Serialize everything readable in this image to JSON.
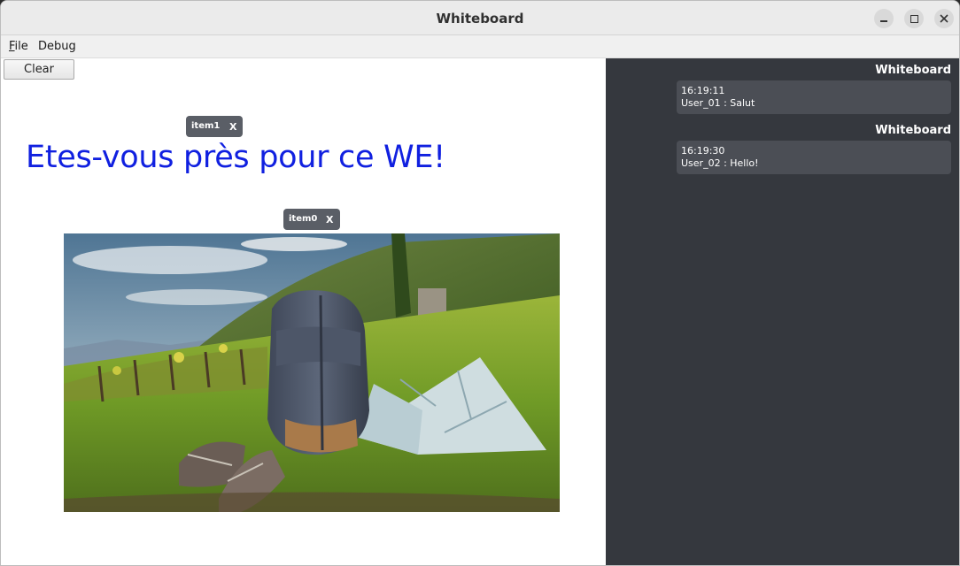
{
  "window": {
    "title": "Whiteboard"
  },
  "menubar": {
    "file_accel": "F",
    "file_rest": "ile",
    "debug_label": "Debug"
  },
  "toolbar": {
    "clear_label": "Clear"
  },
  "canvas": {
    "items": [
      {
        "label": "item1",
        "close": "X"
      },
      {
        "label": "item0",
        "close": "X"
      }
    ],
    "headline": "Etes-vous près pour ce WE!"
  },
  "chat": {
    "messages": [
      {
        "sender": "Whiteboard",
        "time": "16:19:11",
        "text": "User_01 : Salut"
      },
      {
        "sender": "Whiteboard",
        "time": "16:19:30",
        "text": "User_02 : Hello!"
      }
    ]
  },
  "colors": {
    "headline": "#1020e0",
    "chat_bg": "#35383e",
    "bubble": "#4b4e55",
    "tag": "#5a5e66"
  }
}
